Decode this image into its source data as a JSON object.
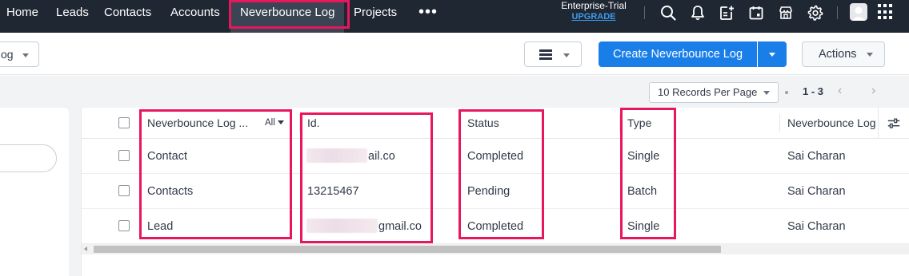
{
  "nav": {
    "items": [
      {
        "label": "Home"
      },
      {
        "label": "Leads"
      },
      {
        "label": "Contacts"
      },
      {
        "label": "Accounts"
      },
      {
        "label": "Neverbounce Log"
      },
      {
        "label": "Projects"
      }
    ],
    "more": "•••",
    "active": "Neverbounce Log"
  },
  "edition": {
    "name": "Enterprise-Trial",
    "upgrade": "UPGRADE"
  },
  "toolbar": {
    "view_partial": "og",
    "create_button": "Create Neverbounce Log",
    "actions_button": "Actions"
  },
  "records": {
    "per_page": "10 Records Per Page",
    "range": "1 - 3"
  },
  "table": {
    "columns": [
      {
        "label": "Neverbounce Log ..."
      },
      {
        "label": "Id."
      },
      {
        "label": "Status"
      },
      {
        "label": "Type"
      },
      {
        "label": "Neverbounce Log"
      }
    ],
    "filter_label": "All",
    "rows": [
      {
        "name": "Contact",
        "id": "ail.co",
        "status": "Completed",
        "type": "Single",
        "owner": "Sai Charan"
      },
      {
        "name": "Contacts",
        "id": "13215467",
        "status": "Pending",
        "type": "Batch",
        "owner": "Sai Charan"
      },
      {
        "name": "Lead",
        "id": "gmail.co",
        "status": "Completed",
        "type": "Single",
        "owner": "Sai Charan"
      }
    ]
  },
  "icons": [
    "search-icon",
    "bell-icon",
    "add-note-icon",
    "calendar-icon",
    "marketplace-icon",
    "gear-icon",
    "apps-grid-icon",
    "list-view-icon",
    "column-settings-icon"
  ],
  "colors": {
    "topbar": "#1f2733",
    "primary": "#1a7ee8",
    "highlight": "#e8175d",
    "upgrade_link": "#3d9bf0"
  }
}
